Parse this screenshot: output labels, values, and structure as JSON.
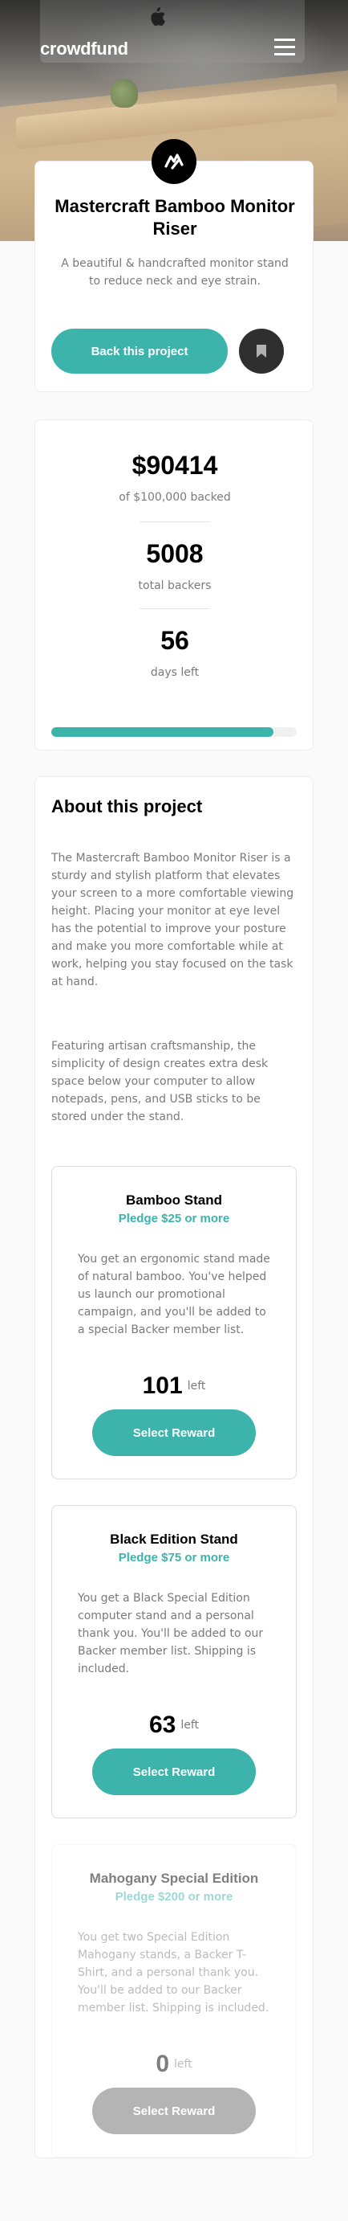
{
  "header": {
    "brand": "crowdfund"
  },
  "project": {
    "title": "Mastercraft Bamboo Monitor Riser",
    "description": "A beautiful & handcrafted monitor stand to reduce neck and eye strain.",
    "back_label": "Back this project"
  },
  "stats": {
    "backed_amount": "$90414",
    "backed_label": "of $100,000 backed",
    "backers": "5008",
    "backers_label": "total backers",
    "days": "56",
    "days_label": "days left",
    "progress_fraction": 0.904
  },
  "about": {
    "title": "About this project",
    "paragraph1": "The Mastercraft Bamboo Monitor Riser is a sturdy and stylish platform that elevates your screen to a more comfortable viewing height. Placing your monitor at eye level has the potential to improve your posture and make you more comfortable while at work, helping you stay focused on the task at hand.",
    "paragraph2": "Featuring artisan craftsmanship, the simplicity of design creates extra desk space below your computer to allow notepads, pens, and USB sticks to be stored under the stand."
  },
  "rewards": [
    {
      "title": "Bamboo Stand",
      "pledge": "Pledge $25 or more",
      "description": "You get an ergonomic stand made of natural bamboo. You've helped us launch our promotional campaign, and you'll be added to a special Backer member list.",
      "count": "101",
      "left_label": "left",
      "button": "Select Reward"
    },
    {
      "title": "Black Edition Stand",
      "pledge": "Pledge $75 or more",
      "description": "You get a Black Special Edition computer stand and a personal thank you. You'll be added to our Backer member list. Shipping is included.",
      "count": "63",
      "left_label": "left",
      "button": "Select Reward"
    },
    {
      "title": "Mahogany Special Edition",
      "pledge": "Pledge $200 or more",
      "description": "You get two Special Edition Mahogany stands, a Backer T-Shirt, and a personal thank you. You'll be added to our Backer member list. Shipping is included.",
      "count": "0",
      "left_label": "left",
      "button": "Select Reward"
    }
  ],
  "colors": {
    "accent": "#3cb4ac",
    "dark": "#2f2f2f"
  },
  "icons": {
    "menu": "hamburger-menu-icon",
    "logo": "mastercraft-logo-icon",
    "bookmark": "bookmark-icon"
  }
}
